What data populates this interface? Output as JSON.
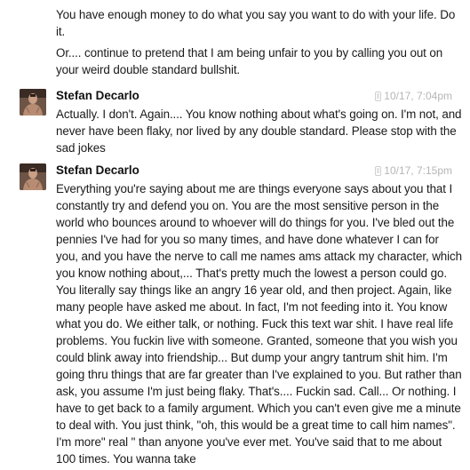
{
  "continuation": {
    "paragraphs": [
      "You have enough money to do what you say you want to do with your life. Do it.",
      "Or.... continue to pretend that I am being unfair to you by calling you out on your weird double standard bullshit."
    ]
  },
  "messages": [
    {
      "sender": "Stefan Decarlo",
      "timestamp": "10/17, 7:04pm",
      "source_icon": "phone-icon",
      "text": "Actually. I don't. Again.... You know nothing about what's going on. I'm not, and never have been flaky, nor lived by any double standard. Please stop with the sad jokes"
    },
    {
      "sender": "Stefan Decarlo",
      "timestamp": "10/17, 7:15pm",
      "source_icon": "phone-icon",
      "text": "Everything you're saying about me are things everyone says about you that I constantly try and defend you on. You are the most sensitive person in the world who bounces around to whoever will do things for you. I've bled out the pennies I've had for you so many times, and have done whatever I can for you, and you have the nerve to call me names ams attack my character, which you know nothing about,... That's pretty much the lowest a person could go. You literally say things like an angry 16 year old, and then project. Again, like many people have asked me about. In fact, I'm not feeding into it. You know what you do. We either talk, or nothing. Fuck this text war shit.  I have real life problems. You fuckin live with someone. Granted, someone that you wish you could blink away into friendship... But dump your angry tantrum shit him. I'm going thru things that are far greater than I've explained to you. But rather than ask, you assume I'm just being flaky.  That's.... Fuckin sad.  Call... Or nothing. I have to get back to a family argument. Which you can't even give me a minute to deal with. You just think, \"oh, this would be a great time to call him names\".  I'm more\" real \" than anyone you've ever met. You've said that to me about 100 times. You wanna take"
    }
  ],
  "colors": {
    "text": "#1a1a1a",
    "timestamp": "#b6b6b6",
    "background": "#ffffff"
  }
}
